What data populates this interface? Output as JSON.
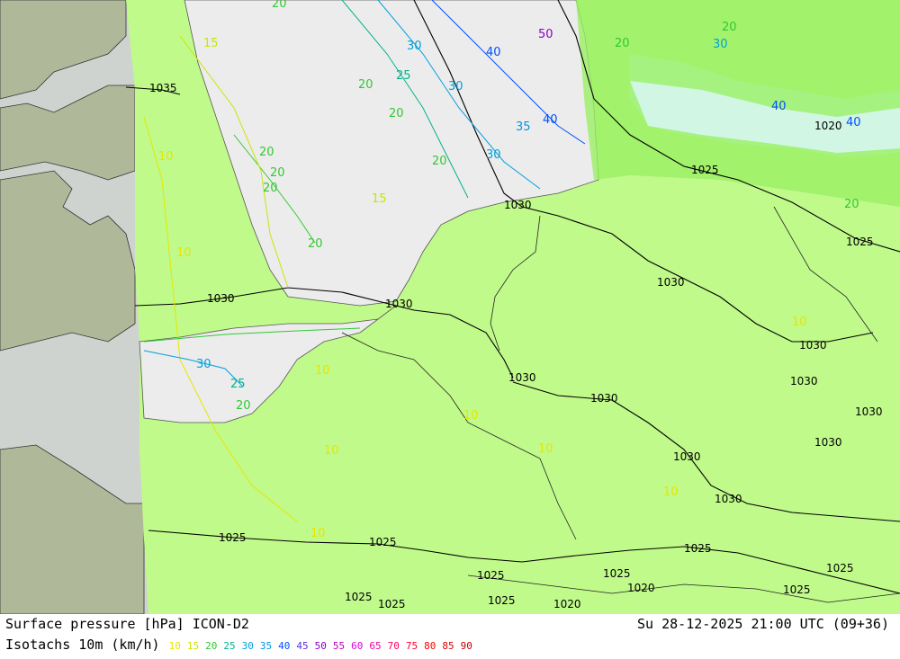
{
  "footer": {
    "title_left": "Surface pressure [hPa] ICON-D2",
    "title_right": "Su 28-12-2025 21:00 UTC (09+36)",
    "legend_label": "Isotachs 10m (km/h)"
  },
  "legend": [
    {
      "value": "10",
      "color": "#e6e600"
    },
    {
      "value": "15",
      "color": "#c8e600"
    },
    {
      "value": "20",
      "color": "#32c832"
    },
    {
      "value": "25",
      "color": "#00b48c"
    },
    {
      "value": "30",
      "color": "#00a0dc"
    },
    {
      "value": "35",
      "color": "#0096e6"
    },
    {
      "value": "40",
      "color": "#0050ff"
    },
    {
      "value": "45",
      "color": "#5a32dc"
    },
    {
      "value": "50",
      "color": "#8c00c8"
    },
    {
      "value": "55",
      "color": "#be00be"
    },
    {
      "value": "60",
      "color": "#dc00dc"
    },
    {
      "value": "65",
      "color": "#f000a0"
    },
    {
      "value": "70",
      "color": "#ff0064"
    },
    {
      "value": "75",
      "color": "#ff0032"
    },
    {
      "value": "80",
      "color": "#ff0000"
    },
    {
      "value": "85",
      "color": "#dc0000"
    },
    {
      "value": "90",
      "color": "#c80000"
    }
  ],
  "colors": {
    "sea_outside": "#cfd3cf",
    "land_outside": "#b0b89a",
    "domain_sea": "#ececec",
    "domain_land": "#c0fa8a",
    "domain_land_dark": "#9af064"
  },
  "pressure_labels": [
    "1035",
    "1030",
    "1030",
    "1030",
    "1030",
    "1030",
    "1030",
    "1030",
    "1030",
    "1030",
    "1030",
    "1030",
    "1030",
    "1025",
    "1025",
    "1025",
    "1025",
    "1025",
    "1025",
    "1025",
    "1025",
    "1025",
    "1025",
    "1025",
    "1020",
    "1020",
    "1020",
    "1025"
  ],
  "isotach_labels": [
    "20",
    "20",
    "20",
    "20",
    "20",
    "20",
    "25",
    "30",
    "30",
    "40",
    "40",
    "40",
    "30",
    "35",
    "20",
    "15",
    "15",
    "10",
    "10",
    "10",
    "10",
    "10",
    "10",
    "10",
    "10",
    "10",
    "30",
    "25",
    "20",
    "20",
    "20",
    "40",
    "20",
    "20",
    "30",
    "50"
  ]
}
